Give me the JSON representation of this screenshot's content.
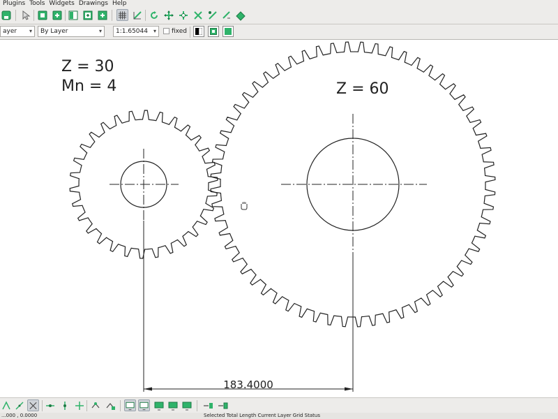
{
  "menubar": {
    "items": [
      "Plugins",
      "Tools",
      "Widgets",
      "Drawings",
      "Help"
    ]
  },
  "toolbar": {
    "icons": [
      "save-icon",
      "select-icon",
      "copy-icon",
      "paste-icon",
      "library-icon",
      "new-window-icon",
      "grid-icon",
      "snap-icon",
      "rotate-icon",
      "move-icon",
      "scale-icon",
      "mirror-icon",
      "trim-icon",
      "properties-icon"
    ]
  },
  "options": {
    "layer_value": "ayer",
    "linetype_value": "By Layer",
    "scale_value": "1:1.65044",
    "fixed_label": "fixed"
  },
  "drawing": {
    "annotation_z": "Z = 30",
    "annotation_mn": "Mn = 4",
    "annotation_z_large": "Z = 60",
    "dimension_value": "183.4000",
    "small_gear": {
      "teeth": 30,
      "module": 4
    },
    "large_gear": {
      "teeth": 60,
      "module": 4
    }
  },
  "statusbar": {
    "coords": "...000 , 0.0000",
    "info": "Selected Total Length  Current Layer  Grid Status"
  },
  "colors": {
    "accent_green": "#2fb36a",
    "line": "#1a1a1a",
    "canvas": "#ffffff"
  }
}
